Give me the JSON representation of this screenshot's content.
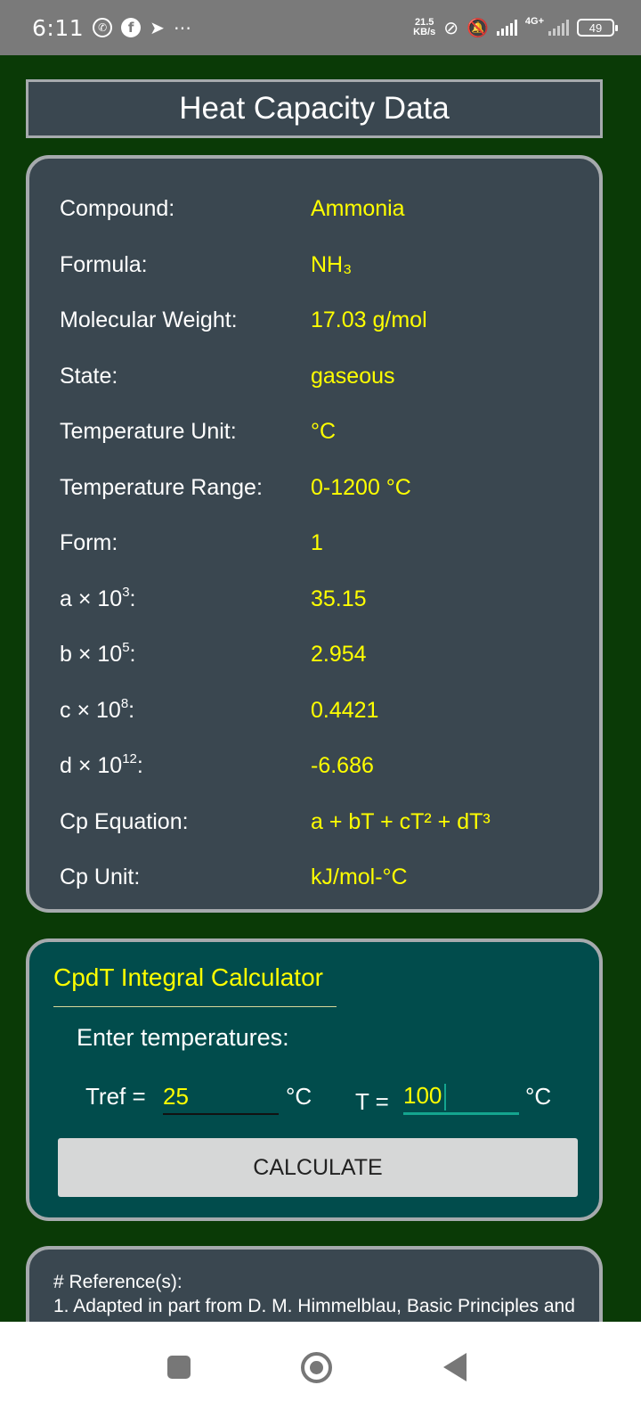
{
  "status_bar": {
    "time": "6:11",
    "more_glyph": "⋯",
    "speed_value": "21.5",
    "speed_unit": "KB/s",
    "network": "4G+",
    "battery": "49"
  },
  "page_title": "Heat Capacity Data",
  "compound_data": [
    {
      "label": "Compound:",
      "value": "Ammonia"
    },
    {
      "label": "Formula:",
      "value": "NH₃"
    },
    {
      "label": "Molecular Weight:",
      "value": "17.03 g/mol"
    },
    {
      "label": "State:",
      "value": "gaseous"
    },
    {
      "label": "Temperature Unit:",
      "value": "°C"
    },
    {
      "label": "Temperature Range:",
      "value": "0-1200 °C"
    },
    {
      "label": "Form:",
      "value": "1"
    },
    {
      "label_base": "a × 10",
      "label_exp": "3",
      "label_suffix": ":",
      "value": "35.15"
    },
    {
      "label_base": "b × 10",
      "label_exp": "5",
      "label_suffix": ":",
      "value": "2.954"
    },
    {
      "label_base": "c × 10",
      "label_exp": "8",
      "label_suffix": ":",
      "value": "0.4421"
    },
    {
      "label_base": "d × 10",
      "label_exp": "12",
      "label_suffix": ":",
      "value": "-6.686"
    },
    {
      "label": "Cp Equation:",
      "value": "a + bT + cT² + dT³"
    },
    {
      "label": "Cp Unit:",
      "value": "kJ/mol-°C"
    }
  ],
  "calculator": {
    "title": "CpdT Integral Calculator",
    "subtitle": "Enter temperatures:",
    "tref_label": "Tref  =",
    "tref_value": "25",
    "tref_unit": "°C",
    "t_label": "T =",
    "t_value": "100",
    "t_unit": "°C",
    "button_label": "CALCULATE"
  },
  "references": {
    "heading": "# Reference(s):",
    "line1": "1. Adapted in part from D. M. Himmelblau, Basic Principles and"
  },
  "colors": {
    "background": "#0a3a06",
    "card": "#3a4750",
    "calc_card": "#014c4c",
    "value_text": "#ffff00",
    "accent": "#14a58f"
  }
}
